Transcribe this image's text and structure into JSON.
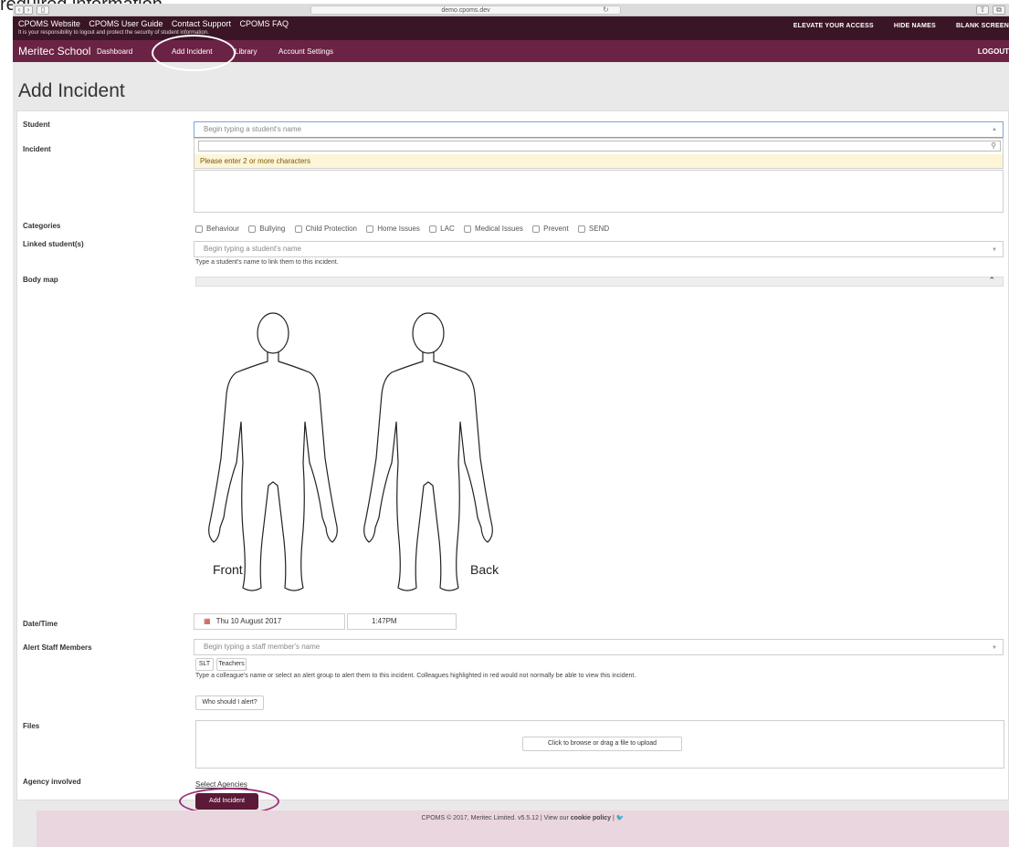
{
  "caption": "required information.",
  "browser": {
    "url": "demo.cpoms.dev"
  },
  "topbar": {
    "links": [
      "CPOMS Website",
      "CPOMS User Guide",
      "Contact Support",
      "CPOMS FAQ"
    ],
    "notice": "It is your responsibility to logout and protect the security of student information.",
    "right": [
      "ELEVATE YOUR ACCESS",
      "HIDE NAMES",
      "BLANK SCREEN"
    ]
  },
  "nav": {
    "brand": "Meritec School",
    "items": [
      "Dashboard",
      "Add Incident",
      "Library",
      "Account Settings"
    ],
    "logout": "LOGOUT"
  },
  "page": {
    "title": "Add Incident"
  },
  "form": {
    "student": {
      "label": "Student",
      "placeholder": "Begin typing a student's name",
      "dropdown_message": "Please enter 2 or more characters"
    },
    "incident": {
      "label": "Incident"
    },
    "categories": {
      "label": "Categories",
      "options": [
        "Behaviour",
        "Bullying",
        "Child Protection",
        "Home Issues",
        "LAC",
        "Medical Issues",
        "Prevent",
        "SEND"
      ]
    },
    "linked": {
      "label": "Linked student(s)",
      "placeholder": "Begin typing a student's name",
      "help": "Type a student's name to link them to this incident."
    },
    "bodymap": {
      "label": "Body map",
      "front": "Front",
      "back": "Back"
    },
    "datetime": {
      "label": "Date/Time",
      "date": "Thu 10 August 2017",
      "time": "1:47PM"
    },
    "alert": {
      "label": "Alert Staff Members",
      "placeholder": "Begin typing a staff member's name",
      "groups": [
        "SLT",
        "Teachers"
      ],
      "help": "Type a colleague's name or select an alert group to alert them to this incident. Colleagues highlighted in red would not normally be able to view this incident.",
      "who_button": "Who should I alert?"
    },
    "files": {
      "label": "Files",
      "button": "Click to browse or drag a file to upload"
    },
    "agency": {
      "label": "Agency involved",
      "link": "Select Agencies"
    },
    "submit": "Add Incident"
  },
  "footer": {
    "text": "CPOMS © 2017, Meritec Limited. v5.5.12 | View our ",
    "cookie": "cookie policy",
    "sep": " | "
  },
  "colors": {
    "topbar": "#3a1525",
    "nav": "#6b2345",
    "primary": "#5a1a38",
    "footer": "#ead6df"
  }
}
